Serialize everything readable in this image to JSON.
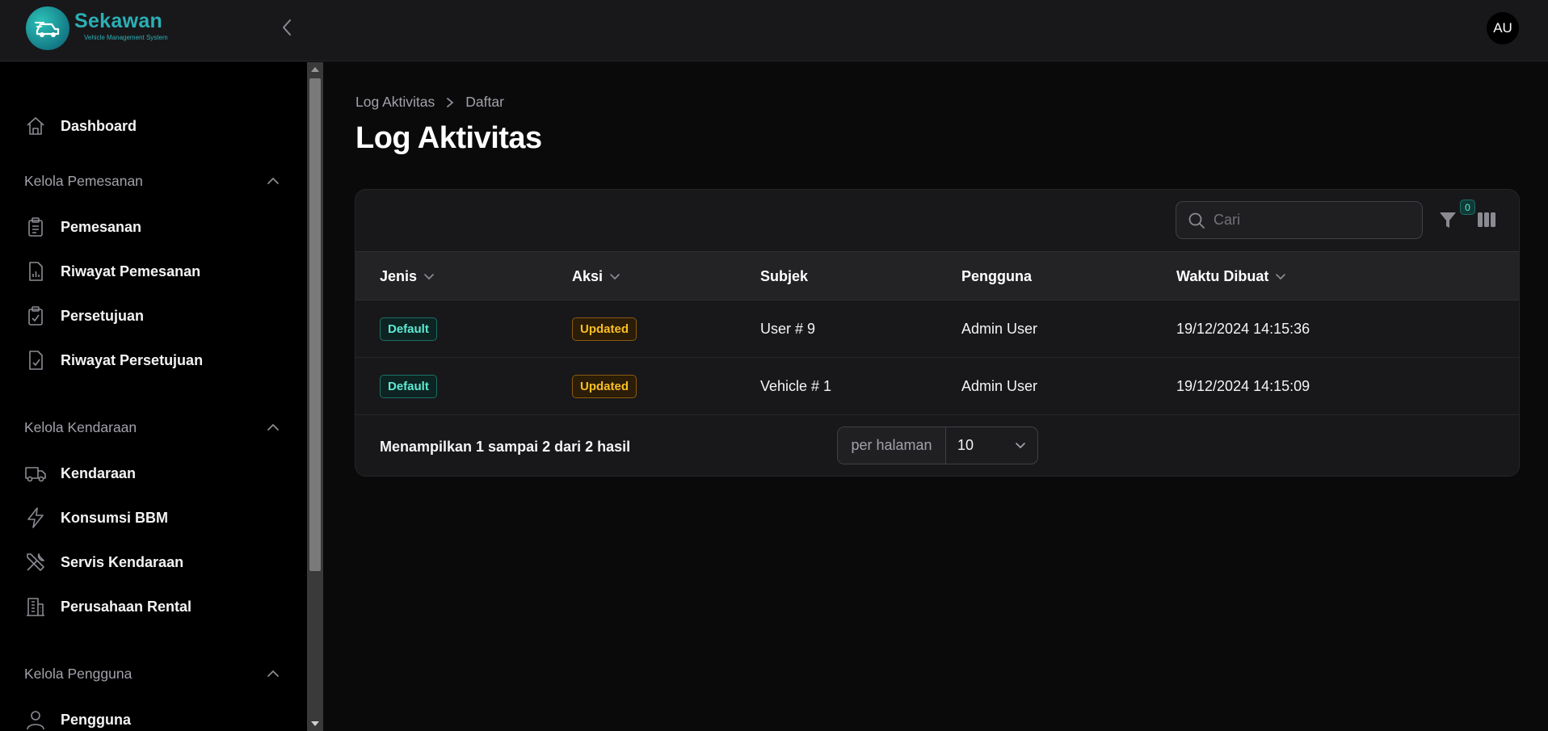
{
  "header": {
    "brand_name": "Sekawan",
    "brand_tagline": "Vehicle Management System",
    "avatar_initials": "AU"
  },
  "sidebar": {
    "dashboard": "Dashboard",
    "groups": [
      {
        "label": "Kelola Pemesanan",
        "items": [
          "Pemesanan",
          "Riwayat Pemesanan",
          "Persetujuan",
          "Riwayat Persetujuan"
        ]
      },
      {
        "label": "Kelola Kendaraan",
        "items": [
          "Kendaraan",
          "Konsumsi BBM",
          "Servis Kendaraan",
          "Perusahaan Rental"
        ]
      },
      {
        "label": "Kelola Pengguna",
        "items": [
          "Pengguna"
        ]
      }
    ]
  },
  "breadcrumb": {
    "parent": "Log Aktivitas",
    "current": "Daftar"
  },
  "page_title": "Log Aktivitas",
  "toolbar": {
    "search_placeholder": "Cari",
    "filter_count": "0"
  },
  "table": {
    "columns": [
      "Jenis",
      "Aksi",
      "Subjek",
      "Pengguna",
      "Waktu Dibuat"
    ],
    "rows": [
      {
        "jenis": "Default",
        "aksi": "Updated",
        "subjek": "User # 9",
        "pengguna": "Admin User",
        "waktu": "19/12/2024 14:15:36"
      },
      {
        "jenis": "Default",
        "aksi": "Updated",
        "subjek": "Vehicle # 1",
        "pengguna": "Admin User",
        "waktu": "19/12/2024 14:15:09"
      }
    ]
  },
  "footer": {
    "summary": "Menampilkan 1 sampai 2 dari 2 hasil",
    "per_page_label": "per halaman",
    "per_page_value": "10"
  },
  "colors": {
    "brand": "#2ab0b5",
    "badge_default": "#5eead4",
    "badge_updated": "#fbbf24"
  }
}
